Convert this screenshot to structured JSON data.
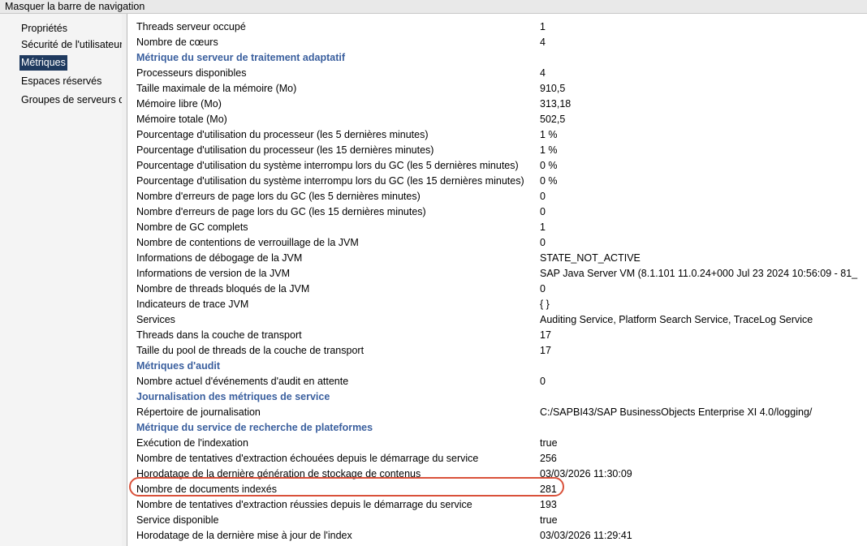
{
  "topbar": {
    "label": "Masquer la barre de navigation"
  },
  "sidebar": {
    "items": [
      {
        "label": "Propriétés",
        "active": false
      },
      {
        "label": "Sécurité de l'utilisateur",
        "active": false
      },
      {
        "label": "Métriques",
        "active": true
      },
      {
        "label": "Espaces réservés",
        "active": false
      },
      {
        "label": "Groupes de serveurs d",
        "active": false
      }
    ]
  },
  "metrics": [
    {
      "type": "row",
      "label": "Threads serveur occupé",
      "value": "1"
    },
    {
      "type": "row",
      "label": "Nombre de cœurs",
      "value": "4"
    },
    {
      "type": "section",
      "label": "Métrique du serveur de traitement adaptatif"
    },
    {
      "type": "row",
      "label": "Processeurs disponibles",
      "value": "4"
    },
    {
      "type": "row",
      "label": "Taille maximale de la mémoire (Mo)",
      "value": "910,5"
    },
    {
      "type": "row",
      "label": "Mémoire libre (Mo)",
      "value": "313,18"
    },
    {
      "type": "row",
      "label": "Mémoire totale (Mo)",
      "value": "502,5"
    },
    {
      "type": "row",
      "label": "Pourcentage d'utilisation du processeur (les 5 dernières minutes)",
      "value": "1 %"
    },
    {
      "type": "row",
      "label": "Pourcentage d'utilisation du processeur (les 15 dernières minutes)",
      "value": "1 %"
    },
    {
      "type": "row",
      "label": "Pourcentage d'utilisation du système interrompu lors du GC (les 5 dernières minutes)",
      "value": "0 %"
    },
    {
      "type": "row",
      "label": "Pourcentage d'utilisation du système interrompu lors du GC (les 15 dernières minutes)",
      "value": "0 %"
    },
    {
      "type": "row",
      "label": "Nombre d'erreurs de page lors du GC (les 5 dernières minutes)",
      "value": "0"
    },
    {
      "type": "row",
      "label": "Nombre d'erreurs de page lors du GC (les 15 dernières minutes)",
      "value": "0"
    },
    {
      "type": "row",
      "label": "Nombre de GC complets",
      "value": "1"
    },
    {
      "type": "row",
      "label": "Nombre de contentions de verrouillage de la JVM",
      "value": "0"
    },
    {
      "type": "row",
      "label": "Informations de débogage de la JVM",
      "value": "STATE_NOT_ACTIVE"
    },
    {
      "type": "row",
      "label": "Informations de version de la JVM",
      "value": "SAP Java Server VM (8.1.101 11.0.24+000 Jul 23 2024 10:56:09 - 81_"
    },
    {
      "type": "row",
      "label": "Nombre de threads bloqués de la JVM",
      "value": "0"
    },
    {
      "type": "row",
      "label": "Indicateurs de trace JVM",
      "value": "{ }"
    },
    {
      "type": "row",
      "label": "Services",
      "value": "Auditing Service, Platform Search Service, TraceLog Service"
    },
    {
      "type": "row",
      "label": "Threads dans la couche de transport",
      "value": "17"
    },
    {
      "type": "row",
      "label": "Taille du pool de threads de la couche de transport",
      "value": "17"
    },
    {
      "type": "section",
      "label": "Métriques d'audit"
    },
    {
      "type": "row",
      "label": "Nombre actuel d'événements d'audit en attente",
      "value": "0"
    },
    {
      "type": "section",
      "label": "Journalisation des métriques de service"
    },
    {
      "type": "row",
      "label": "Répertoire de journalisation",
      "value": "C:/SAPBI43/SAP BusinessObjects Enterprise XI 4.0/logging/"
    },
    {
      "type": "section",
      "label": "Métrique du service de recherche de plateformes"
    },
    {
      "type": "row",
      "label": "Exécution de l'indexation",
      "value": "true"
    },
    {
      "type": "row",
      "label": "Nombre de tentatives d'extraction échouées depuis le démarrage du service",
      "value": "256"
    },
    {
      "type": "row",
      "label": "Horodatage de la dernière génération de stockage de contenus",
      "value": "03/03/2026 11:30:09"
    },
    {
      "type": "row",
      "label": "Nombre de documents indexés",
      "value": "281",
      "highlighted": true
    },
    {
      "type": "row",
      "label": "Nombre de tentatives d'extraction réussies depuis le démarrage du service",
      "value": "193"
    },
    {
      "type": "row",
      "label": "Service disponible",
      "value": "true"
    },
    {
      "type": "row",
      "label": "Horodatage de la dernière mise à jour de l'index",
      "value": "03/03/2026 11:29:41"
    }
  ],
  "colors": {
    "section_heading": "#3a5f9e",
    "nav_active_bg": "#1f3a5f",
    "highlight_border": "#d9513a"
  }
}
